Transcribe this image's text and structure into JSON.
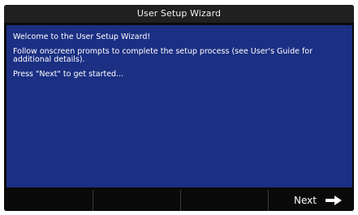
{
  "window": {
    "title": "User Setup Wizard"
  },
  "content": {
    "welcome": "Welcome to the User Setup Wizard!",
    "instructions": "Follow onscreen prompts to complete the setup process (see User's Guide for additional details).",
    "start_prompt": "Press \"Next\" to get started..."
  },
  "softkeys": {
    "key1_label": "",
    "key2_label": "",
    "key3_label": "",
    "next_label": "Next",
    "next_icon": "right-arrow-icon"
  },
  "colors": {
    "content_background": "#1b2f83",
    "bezel": "#0a0a0a",
    "title_bar": "#202020",
    "text": "#ffffff"
  }
}
